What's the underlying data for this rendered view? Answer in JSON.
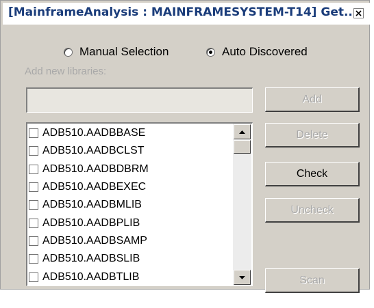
{
  "window": {
    "title": "[MainframeAnalysis : MAINFRAMESYSTEM-T14] Get...",
    "close_icon": "close-icon"
  },
  "source_options": [
    {
      "label": "Manual Selection",
      "checked": false
    },
    {
      "label": "Auto Discovered",
      "checked": true
    }
  ],
  "add_section": {
    "label": "Add new libraries:",
    "input_value": ""
  },
  "buttons": {
    "add": "Add",
    "delete": "Delete",
    "check": "Check",
    "uncheck": "Uncheck",
    "scan": "Scan"
  },
  "libraries": [
    {
      "name": "ADB510.AADBBASE",
      "checked": false
    },
    {
      "name": "ADB510.AADBCLST",
      "checked": false
    },
    {
      "name": "ADB510.AADBDBRM",
      "checked": false
    },
    {
      "name": "ADB510.AADBEXEC",
      "checked": false
    },
    {
      "name": "ADB510.AADBMLIB",
      "checked": false
    },
    {
      "name": "ADB510.AADBPLIB",
      "checked": false
    },
    {
      "name": "ADB510.AADBSAMP",
      "checked": false
    },
    {
      "name": "ADB510.AADBSLIB",
      "checked": false
    },
    {
      "name": "ADB510.AADBTLIB",
      "checked": false
    }
  ],
  "colors": {
    "title_text": "#1a3c7a",
    "dialog_bg": "#d4d0c8",
    "disabled_text": "#a8a8a8"
  }
}
